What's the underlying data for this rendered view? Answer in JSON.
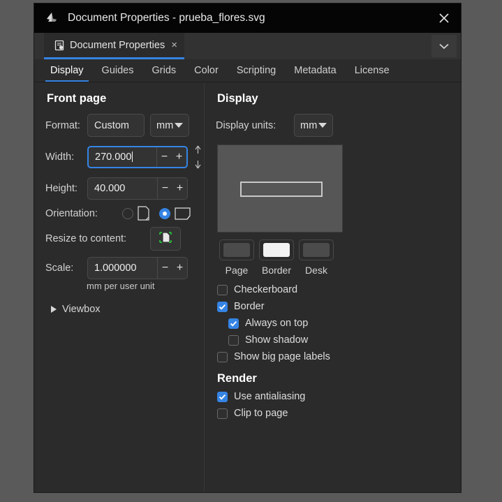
{
  "window": {
    "title": "Document Properties - prueba_flores.svg",
    "app_icon": "inkscape-logo-icon",
    "close_label": "×"
  },
  "dock": {
    "tab": {
      "icon": "document-properties-icon",
      "label": "Document Properties",
      "close": "×"
    },
    "menu_icon": "chevron-down-icon"
  },
  "section_tabs": [
    {
      "label": "Display",
      "active": true
    },
    {
      "label": "Guides",
      "active": false
    },
    {
      "label": "Grids",
      "active": false
    },
    {
      "label": "Color",
      "active": false
    },
    {
      "label": "Scripting",
      "active": false
    },
    {
      "label": "Metadata",
      "active": false
    },
    {
      "label": "License",
      "active": false
    }
  ],
  "front_page": {
    "heading": "Front page",
    "format_label": "Format:",
    "format_value": "Custom",
    "format_unit": "mm",
    "width_label": "Width:",
    "width_value": "270.000",
    "height_label": "Height:",
    "height_value": "40.000",
    "minus": "−",
    "plus": "+",
    "swap_icon": "swap-width-height-icon",
    "orientation_label": "Orientation:",
    "orientation_portrait": "portrait-page-icon",
    "orientation_landscape": "landscape-page-icon",
    "orientation_selected": "landscape",
    "resize_label": "Resize to content:",
    "resize_icon": "fit-page-to-content-icon",
    "scale_label": "Scale:",
    "scale_value": "1.000000",
    "scale_hint": "mm per user unit",
    "viewbox_label": "Viewbox",
    "viewbox_expanded": false
  },
  "display": {
    "heading": "Display",
    "units_label": "Display units:",
    "units_value": "mm",
    "preview_name": "page-preview",
    "swatches": [
      {
        "label": "Page",
        "color": "#4b4b4b"
      },
      {
        "label": "Border",
        "color": "#f2f2f2"
      },
      {
        "label": "Desk",
        "color": "#4b4b4b"
      }
    ],
    "checkboxes": [
      {
        "label": "Checkerboard",
        "checked": false,
        "indent": false
      },
      {
        "label": "Border",
        "checked": true,
        "indent": false
      },
      {
        "label": "Always on top",
        "checked": true,
        "indent": true
      },
      {
        "label": "Show shadow",
        "checked": false,
        "indent": true
      },
      {
        "label": "Show big page labels",
        "checked": false,
        "indent": false
      }
    ],
    "render_heading": "Render",
    "render_checkboxes": [
      {
        "label": "Use antialiasing",
        "checked": true
      },
      {
        "label": "Clip to page",
        "checked": false
      }
    ]
  },
  "colors": {
    "accent": "#3584e4",
    "window_bg": "#2b2b2b",
    "titlebar_bg": "#050505",
    "desktop_bg": "#5a5a5a",
    "preview_bg": "#565656"
  }
}
